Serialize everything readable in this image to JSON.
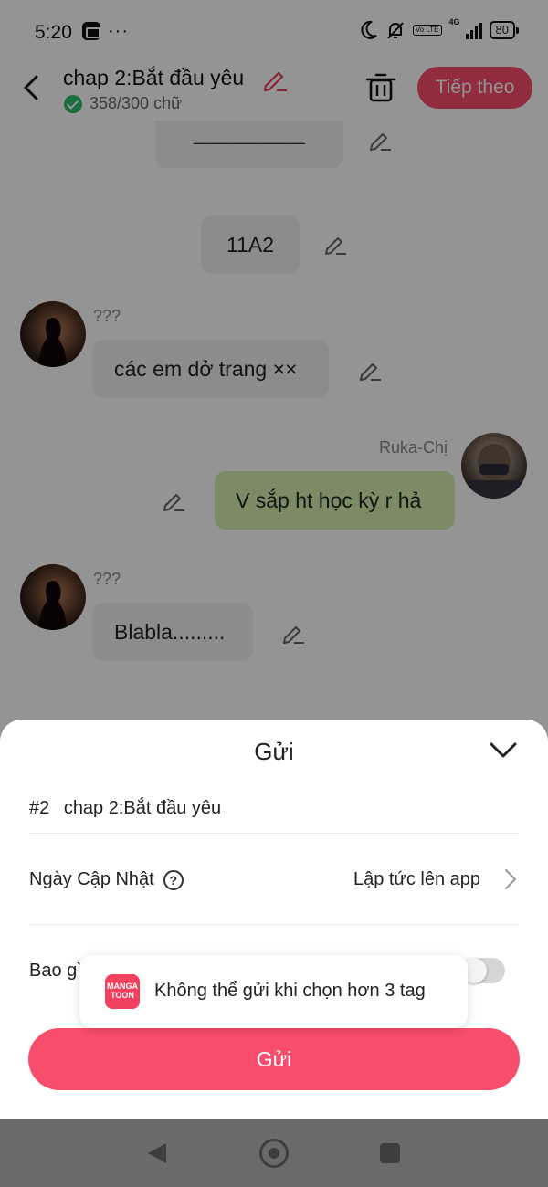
{
  "status_bar": {
    "time": "5:20",
    "dots": "···",
    "volte": "Vo LTE",
    "network": "4G",
    "battery": "80"
  },
  "header": {
    "title": "chap 2:Bắt đầu yêu",
    "word_count": "358/300 chữ",
    "next_label": "Tiếp theo"
  },
  "chat": {
    "partial_top": "___________",
    "location_tag": "11A2",
    "messages": [
      {
        "sender": "???",
        "text": "các em dở trang ××",
        "side": "left"
      },
      {
        "sender": "Ruka-Chị",
        "text": "V sắp ht học kỳ r hả",
        "side": "right"
      },
      {
        "sender": "???",
        "text": "Blabla.........",
        "side": "left"
      }
    ]
  },
  "sheet": {
    "title": "Gửi",
    "chapter_number": "#2",
    "chapter_name": "chap 2:Bắt đầu yêu",
    "update_label": "Ngày Cập Nhật",
    "help_glyph": "?",
    "update_value": "Lập tức lên app",
    "bao_label": "Bao gì",
    "send_label": "Gửi"
  },
  "toast": {
    "logo_line1": "MANGA",
    "logo_line2": "TOON",
    "message": "Không thể gửi khi chọn hơn 3 tag"
  },
  "colors": {
    "accent": "#f84d6c",
    "right_bubble": "#d4efae",
    "check": "#2bbf6a"
  }
}
